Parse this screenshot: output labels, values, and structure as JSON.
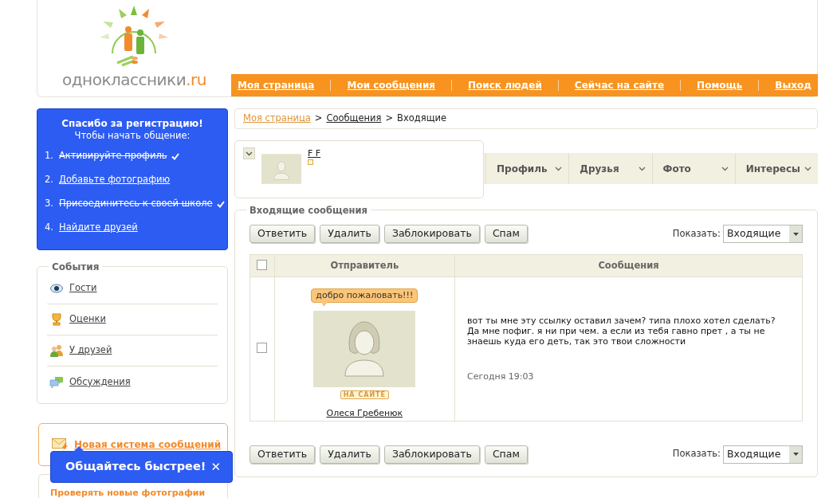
{
  "logo": {
    "name": "одноклассники",
    "domain": ".ru"
  },
  "nav": [
    {
      "label": "Моя страница"
    },
    {
      "label": "Мои сообщения"
    },
    {
      "label": "Поиск людей"
    },
    {
      "label": "Сейчас на сайте"
    },
    {
      "label": "Помощь"
    },
    {
      "label": "Выход"
    }
  ],
  "registration": {
    "title": "Спасибо за регистрацию!",
    "subtitle": "Чтобы начать общение:",
    "steps": [
      {
        "number": "1.",
        "label": "Активируйте профиль",
        "done": true
      },
      {
        "number": "2.",
        "label": "Добавьте фотографию",
        "done": false
      },
      {
        "number": "3.",
        "label": "Присоединитесь к своей школе",
        "done": true
      },
      {
        "number": "4.",
        "label": "Найдите друзей",
        "done": false
      }
    ]
  },
  "events": {
    "title": "События",
    "items": [
      {
        "kind": "eye",
        "label": "Гости"
      },
      {
        "kind": "trophy",
        "label": "Оценки"
      },
      {
        "kind": "people",
        "label": "У друзей"
      },
      {
        "kind": "chat",
        "label": "Обсуждения"
      }
    ]
  },
  "promo": {
    "link": "Новая система сообщений"
  },
  "next_card": {
    "title": "Проверять новые фотографии"
  },
  "tooltip": {
    "text": "Общайтесь быстрее!",
    "close": "✕"
  },
  "breadcrumb": [
    {
      "kind": "home",
      "label": "Моя страница"
    },
    {
      "kind": "separator",
      "label": ">"
    },
    {
      "kind": "link",
      "label": "Сообщения"
    },
    {
      "kind": "separator",
      "label": ">"
    },
    {
      "kind": "current",
      "label": "Входящие"
    }
  ],
  "profile": {
    "name": "F F",
    "expanded": false,
    "tabs": [
      {
        "label": "Профиль"
      },
      {
        "label": "Друзья"
      },
      {
        "label": "Фото"
      },
      {
        "label": "Интересы"
      }
    ]
  },
  "messages": {
    "title": "Входящие сообщения",
    "actions": [
      "Ответить",
      "Удалить",
      "Заблокировать",
      "Спам"
    ],
    "show_label": "Показать:",
    "show_value": "Входящие",
    "select_all": {
      "checked": false
    },
    "columns": [
      "Отправитель",
      "Сообщения"
    ],
    "rows": [
      {
        "checked": false,
        "bubble": "добро пожаловать!!!",
        "online": "НА САЙТЕ",
        "sender": "Олеся Гребенюк",
        "text": "вот ты мне эту ссылку оставил зачем? типа плохо хотел сделать? Да мне пофиг. я ни при чем. а если из тебя гавно прет , а ты не знаешь куда его деть, так это твои сложности",
        "time": "Сегодня 19:03"
      }
    ],
    "bottom_actions": [
      "Ответить",
      "Удалить",
      "Заблокировать",
      "Спам"
    ],
    "bottom_show_label": "Показать:",
    "bottom_show_value": "Входящие"
  }
}
